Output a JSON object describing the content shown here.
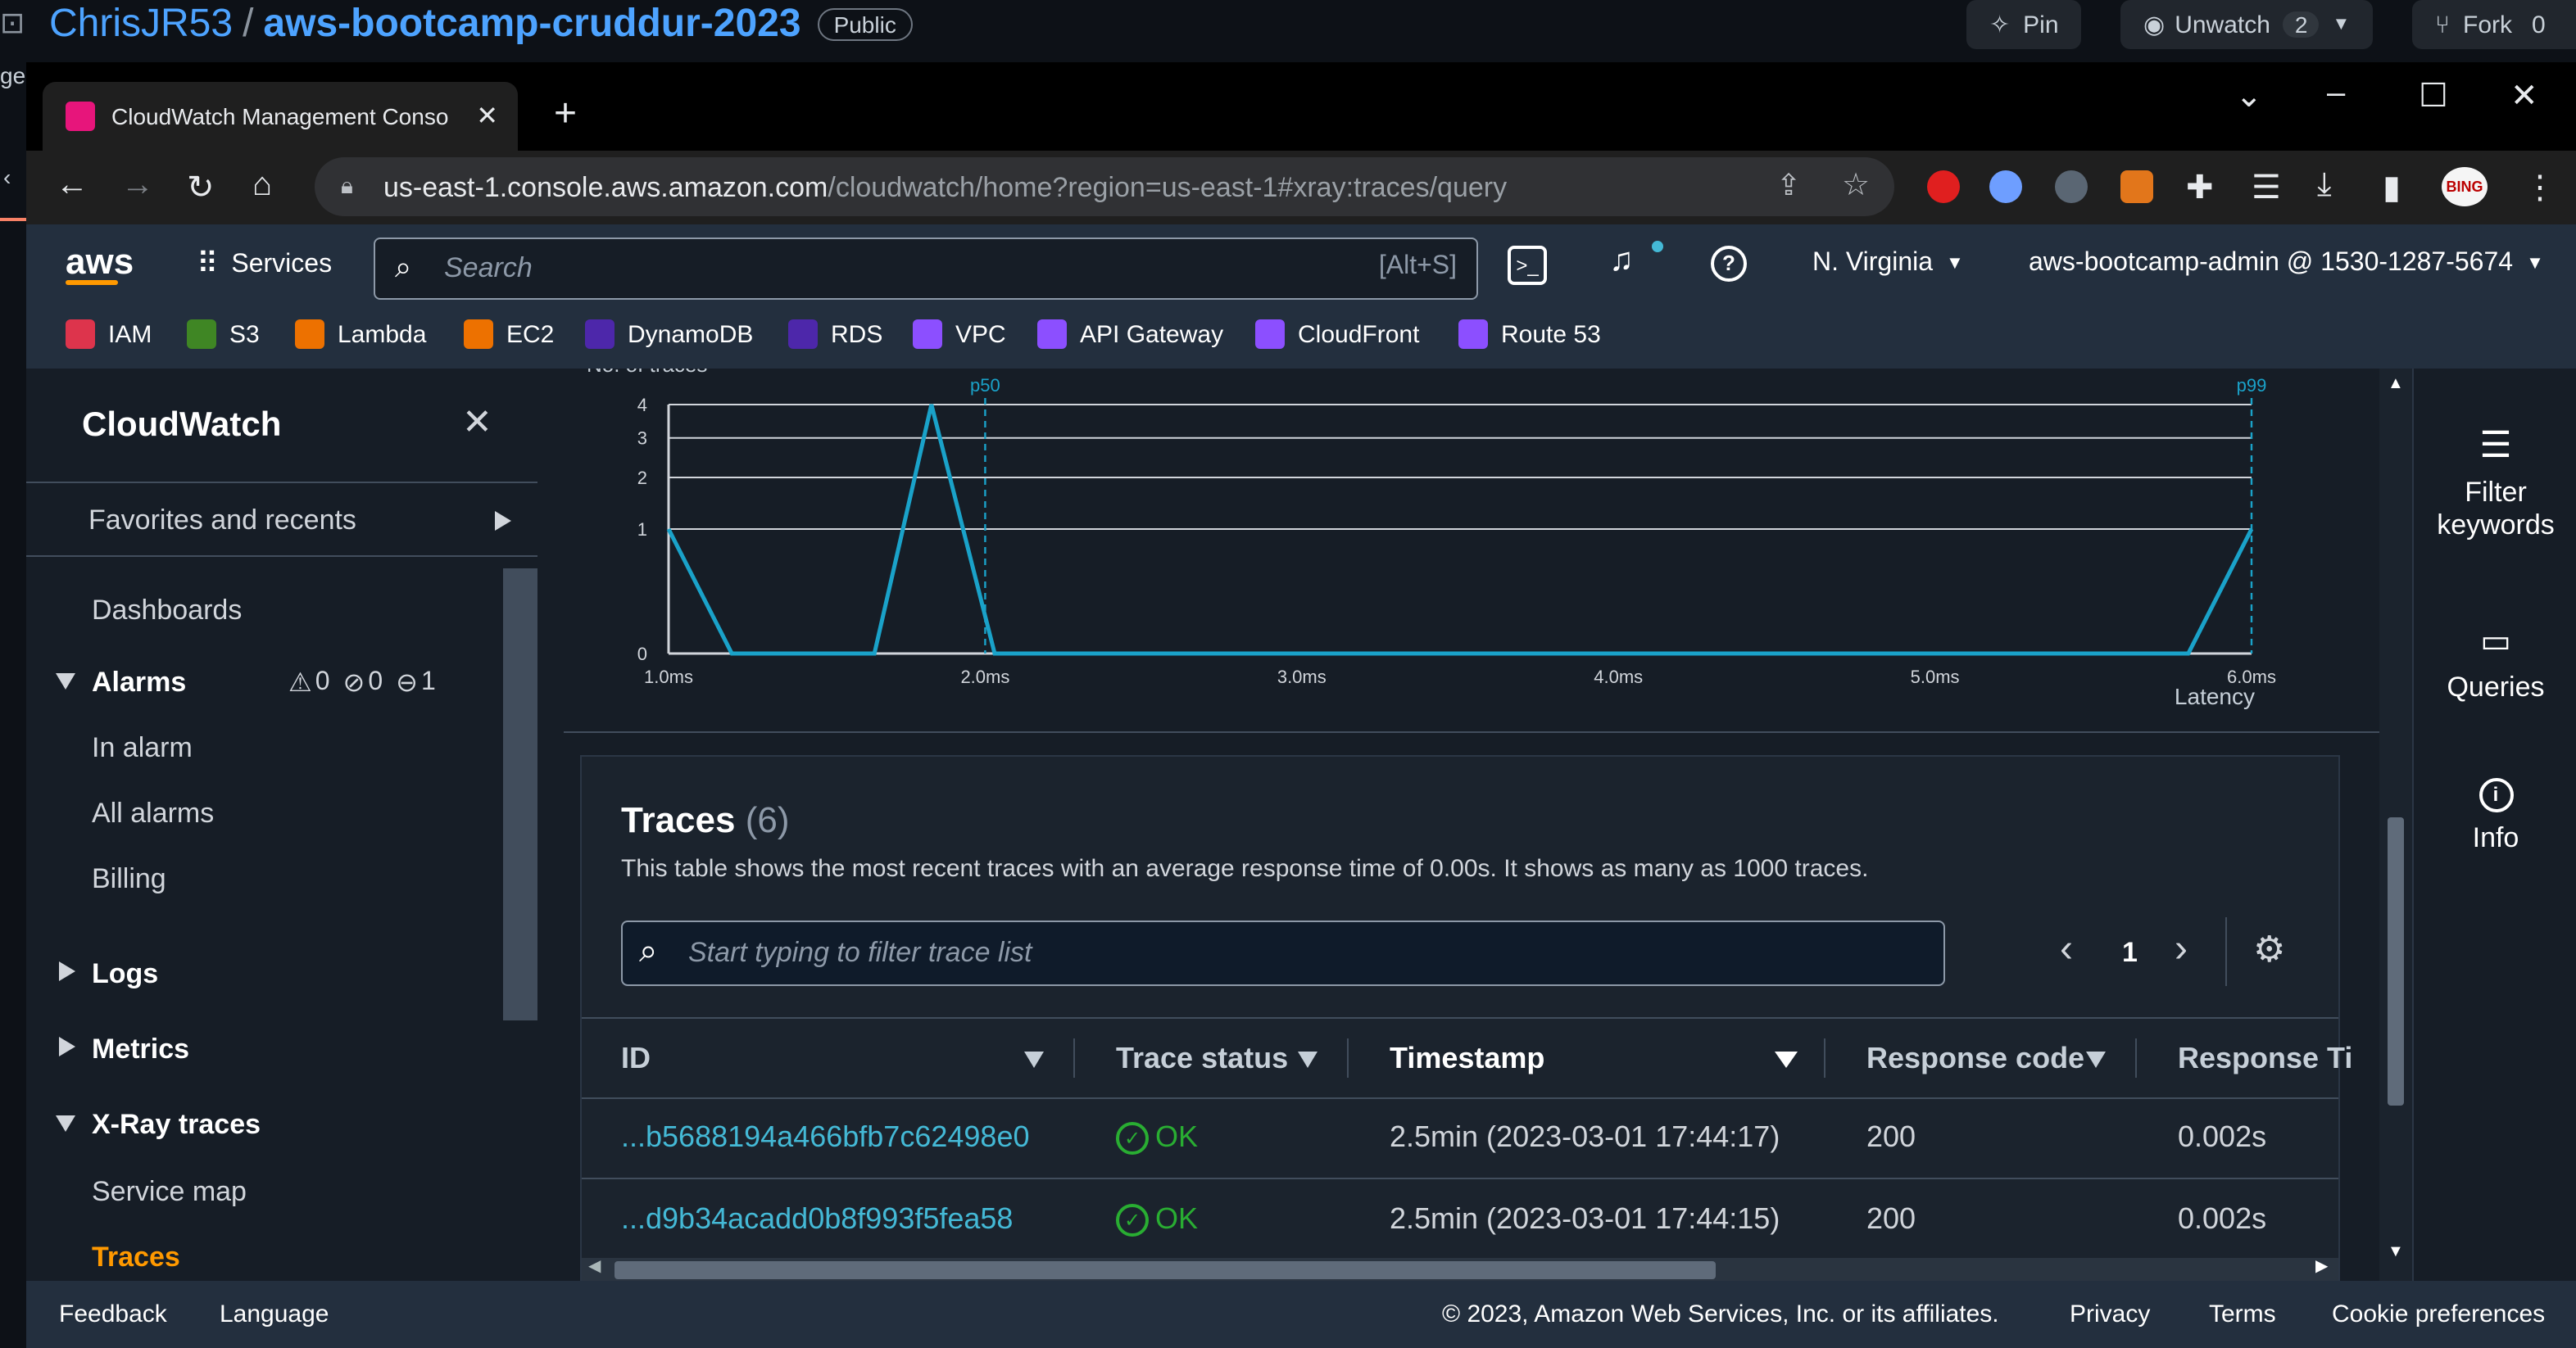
{
  "github": {
    "owner": "ChrisJR53",
    "separator": "/",
    "repo": "aws-bootcamp-cruddur-2023",
    "visibility": "Public",
    "pin": "Pin",
    "unwatch": "Unwatch",
    "watch_count": "2",
    "fork": "Fork",
    "fork_count": "0",
    "left_fragment": "ge"
  },
  "browser": {
    "tab_title": "CloudWatch Management Conso",
    "url_host": "us-east-1.console.aws.amazon.com",
    "url_path": "/cloudwatch/home?region=us-east-1#xray:traces/query",
    "bing_label": "BING"
  },
  "aws_header": {
    "logo": "aws",
    "services": "Services",
    "search_placeholder": "Search",
    "search_shortcut": "[Alt+S]",
    "region": "N. Virginia",
    "account": "aws-bootcamp-admin @ 1530-1287-5674"
  },
  "favorites": [
    "IAM",
    "S3",
    "Lambda",
    "EC2",
    "DynamoDB",
    "RDS",
    "VPC",
    "API Gateway",
    "CloudFront",
    "Route 53"
  ],
  "favorite_colors": [
    "#dd344c",
    "#3f8624",
    "#ed7100",
    "#ed7100",
    "#4d27aa",
    "#4d27aa",
    "#8c4fff",
    "#8c4fff",
    "#8c4fff",
    "#8c4fff"
  ],
  "sidebar": {
    "title": "CloudWatch",
    "favorites": "Favorites and recents",
    "dashboards": "Dashboards",
    "alarms": "Alarms",
    "alarm_counts": {
      "in_alarm": "0",
      "ok": "0",
      "insufficient": "1"
    },
    "in_alarm": "In alarm",
    "all_alarms": "All alarms",
    "billing": "Billing",
    "logs": "Logs",
    "metrics": "Metrics",
    "xray": "X-Ray traces",
    "service_map": "Service map",
    "traces": "Traces"
  },
  "chart_data": {
    "type": "line",
    "ylabel": "No. of traces",
    "xlabel": "Latency",
    "x": [
      1.0,
      1.2,
      1.65,
      1.83,
      2.03,
      5.8,
      6.0
    ],
    "y": [
      1,
      0,
      0,
      4,
      0,
      0,
      1
    ],
    "xticks": [
      "1.0ms",
      "2.0ms",
      "3.0ms",
      "4.0ms",
      "5.0ms",
      "6.0ms"
    ],
    "xtick_values": [
      1,
      2,
      3,
      4,
      5,
      6
    ],
    "yticks": [
      "0",
      "1",
      "2",
      "3",
      "4"
    ],
    "ytick_values": [
      0,
      1,
      2,
      3,
      4
    ],
    "xlim": [
      1.0,
      6.0
    ],
    "ylim": [
      0,
      4
    ],
    "y_scale": "sqrt",
    "markers": [
      {
        "label": "p50",
        "x": 2.0
      },
      {
        "label": "p99",
        "x": 6.0
      }
    ],
    "line_color": "#1aa2c9"
  },
  "traces": {
    "title": "Traces",
    "count": "(6)",
    "description": "This table shows the most recent traces with an average response time of 0.00s. It shows as many as 1000 traces.",
    "filter_placeholder": "Start typing to filter trace list",
    "page": "1",
    "columns": [
      "ID",
      "Trace status",
      "Timestamp",
      "Response code",
      "Response Ti"
    ],
    "rows": [
      {
        "id": "...b5688194a466bfb7c62498e0",
        "status": "OK",
        "timestamp": "2.5min (2023-03-01 17:44:17)",
        "code": "200",
        "time": "0.002s"
      },
      {
        "id": "...d9b34acadd0b8f993f5fea58",
        "status": "OK",
        "timestamp": "2.5min (2023-03-01 17:44:15)",
        "code": "200",
        "time": "0.002s"
      }
    ]
  },
  "right_panel": {
    "filter_keywords": "Filter keywords",
    "queries": "Queries",
    "info": "Info"
  },
  "footer": {
    "feedback": "Feedback",
    "language": "Language",
    "copyright": "© 2023, Amazon Web Services, Inc. or its affiliates.",
    "privacy": "Privacy",
    "terms": "Terms",
    "cookie": "Cookie preferences"
  }
}
